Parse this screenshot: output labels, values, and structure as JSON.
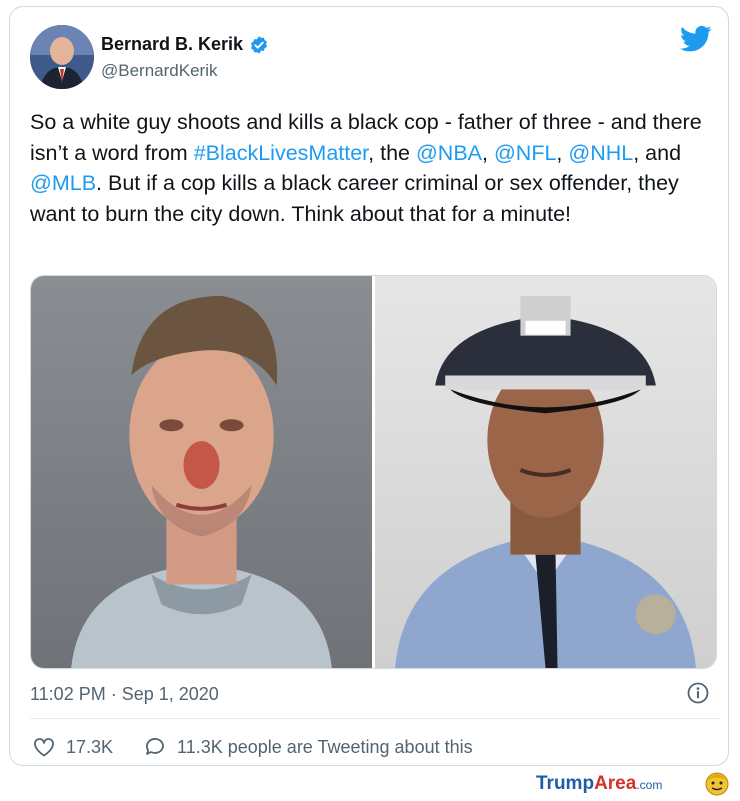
{
  "tweet": {
    "author_name": "Bernard B. Kerik",
    "author_handle": "@BernardKerik",
    "text_segments": [
      {
        "text": "So a white guy shoots and kills a black cop - father of three - and there isn’t a word from ",
        "link": false
      },
      {
        "text": "#BlackLivesMatter",
        "link": true
      },
      {
        "text": ", the ",
        "link": false
      },
      {
        "text": "@NBA",
        "link": true
      },
      {
        "text": ", ",
        "link": false
      },
      {
        "text": "@NFL",
        "link": true
      },
      {
        "text": ", ",
        "link": false
      },
      {
        "text": "@NHL",
        "link": true
      },
      {
        "text": ", and ",
        "link": false
      },
      {
        "text": "@MLB",
        "link": true
      },
      {
        "text": ". But if a cop kills a black career criminal or sex offender, they want to burn the city down. Think about that for a minute!",
        "link": false
      }
    ],
    "timestamp": "11:02 PM · Sep 1, 2020",
    "likes": "17.3K",
    "tweeting_about": "11.3K people are Tweeting about this"
  },
  "icons": {
    "verified": "verified-badge-icon",
    "brand": "twitter-bird-icon",
    "info": "info-icon",
    "like": "heart-icon",
    "reply": "speech-bubble-icon"
  },
  "watermark": {
    "part1": "Trump",
    "part2": "Area",
    "part3": ".com"
  },
  "colors": {
    "link": "#1d9bf0",
    "muted": "#536471",
    "verified": "#1d9bf0"
  }
}
